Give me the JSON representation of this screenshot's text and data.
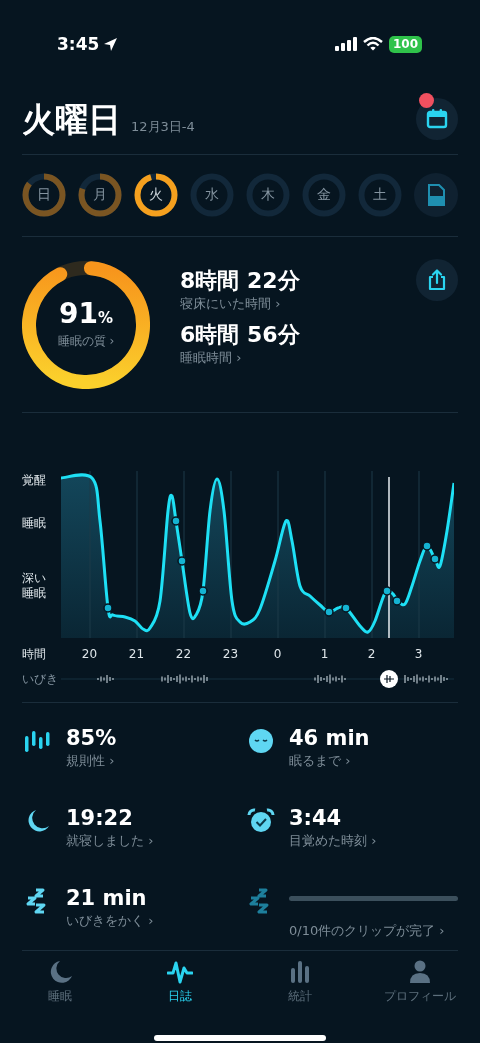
{
  "status_bar": {
    "time": "3:45",
    "battery": "100"
  },
  "header": {
    "title": "火曜日",
    "date": "12月3日-4",
    "calendar_badge": true
  },
  "days": [
    {
      "kind": "day",
      "label": "日",
      "level": 0.85,
      "selected": false
    },
    {
      "kind": "day",
      "label": "月",
      "level": 0.8,
      "selected": false
    },
    {
      "kind": "day",
      "label": "火",
      "level": 0.95,
      "selected": true
    },
    {
      "kind": "day",
      "label": "水",
      "selected": false
    },
    {
      "kind": "day",
      "label": "木",
      "selected": false
    },
    {
      "kind": "day",
      "label": "金",
      "selected": false
    },
    {
      "kind": "day",
      "label": "土",
      "selected": false
    },
    {
      "kind": "report",
      "selected": false
    }
  ],
  "summary": {
    "quality": {
      "value": "91",
      "unit": "%",
      "label": "睡眠の質 ›",
      "level": 0.91
    },
    "durations": [
      {
        "value": "8時間 22分",
        "label": "寝床にいた時間 ›"
      },
      {
        "value": "6時間 56分",
        "label": "睡眠時間 ›"
      }
    ]
  },
  "sleep_graph": {
    "stages": [
      "覚醒",
      "睡眠",
      "深い睡眠"
    ],
    "time_label": "時間",
    "hours": [
      "20",
      "21",
      "22",
      "23",
      "0",
      "1",
      "2",
      "3"
    ],
    "snore_label": "いびき"
  },
  "stats": [
    {
      "kind": "regularity",
      "value": "85%",
      "label": "規則性 ›"
    },
    {
      "kind": "latency",
      "value": "46 min",
      "label": "眠るまで ›"
    },
    {
      "kind": "bedtime",
      "value": "19:22",
      "label": "就寝しました ›"
    },
    {
      "kind": "wake",
      "value": "3:44",
      "label": "目覚めた時刻 ›"
    },
    {
      "kind": "snoring",
      "value": "21 min",
      "label": "いびきをかく ›"
    },
    {
      "kind": "clips",
      "level": 0,
      "label": "0/10件のクリップが完了 ›"
    }
  ],
  "tabs": [
    {
      "kind": "sleep",
      "label": "睡眠",
      "selected": false
    },
    {
      "kind": "journal",
      "label": "日誌",
      "selected": true
    },
    {
      "kind": "stats",
      "label": "統計",
      "selected": false
    },
    {
      "kind": "profile",
      "label": "プロフィール",
      "selected": false
    }
  ]
}
